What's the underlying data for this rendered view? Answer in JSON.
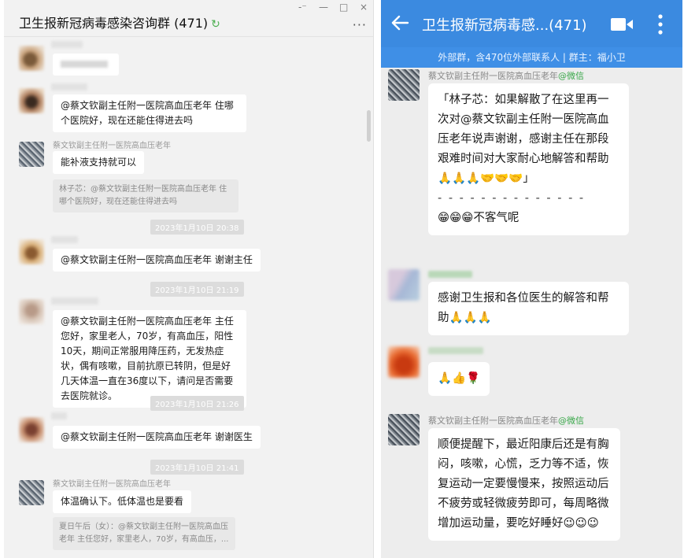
{
  "left": {
    "window": {
      "title": "卫生报新冠病毒感染咨询群 (471)",
      "pin": "-⁻",
      "minimize": "—",
      "maximize": "□",
      "close": "×",
      "more": "···"
    },
    "messages": {
      "m3": {
        "sender": "蔡文钦副主任附一医院高血压老年",
        "text": "能补液支持就可以",
        "quote": "林子芯：@蔡文钦副主任附一医院高血压老年 住哪个医院好，现在还能住得进去吗"
      },
      "m2": {
        "text": "@蔡文钦副主任附一医院高血压老年 住哪个医院好，现在还能住得进去吗"
      },
      "t1": "2023年1月10日 20:38",
      "m4": {
        "text": "@蔡文钦副主任附一医院高血压老年 谢谢主任"
      },
      "t2": "2023年1月10日 21:19",
      "m5": {
        "text": "@蔡文钦副主任附一医院高血压老年 主任您好，家里老人，70岁，有高血压，阳性10天，期间正常服用降压药，无发热症状，偶有咳嗽，目前抗原已转阴，但是好几天体温一直在36度以下，请问是否需要去医院就诊。"
      },
      "t3": "2023年1月10日 21:26",
      "m6": {
        "text": "@蔡文钦副主任附一医院高血压老年 谢谢医生"
      },
      "t4": "2023年1月10日 21:41",
      "m7": {
        "sender": "蔡文钦副主任附一医院高血压老年",
        "text": "体温确认下。低体温也是要看",
        "quote": "夏日午后（女）：@蔡文钦副主任附一医院高血压老年 主任您好，家里老人，70岁，有高血压，..."
      }
    }
  },
  "right": {
    "header": {
      "title": "卫生报新冠病毒感...(471)"
    },
    "subheader": {
      "text": "外部群，含470位外部联系人 | 群主：福小卫"
    },
    "messages": {
      "r1": {
        "sender": "蔡文钦副主任附一医院高血压老年",
        "tag": "@微信",
        "text": "「林子芯：如果解散了在这里再一次对@蔡文钦副主任附一医院高血压老年说声谢谢，感谢主任在那段艰难时间对大家耐心地解答和帮助🙏🙏🙏🤝🤝🤝」",
        "divider": "- - - - - - - - - - - - - -",
        "reply": "😁😁😁不客气呢"
      },
      "r2": {
        "text": "感谢卫生报和各位医生的解答和帮助🙏🙏🙏"
      },
      "r3": {
        "text": "🙏👍🌹"
      },
      "r4": {
        "sender": "蔡文钦副主任附一医院高血压老年",
        "tag": "@微信",
        "text": "顺便提醒下，最近阳康后还是有胸闷，咳嗽，心慌，乏力等不适，恢复运动一定要慢慢来，按照运动后不疲劳或轻微疲劳即可，每周略微增加运动量，要吃好睡好😉😉😉"
      }
    }
  }
}
